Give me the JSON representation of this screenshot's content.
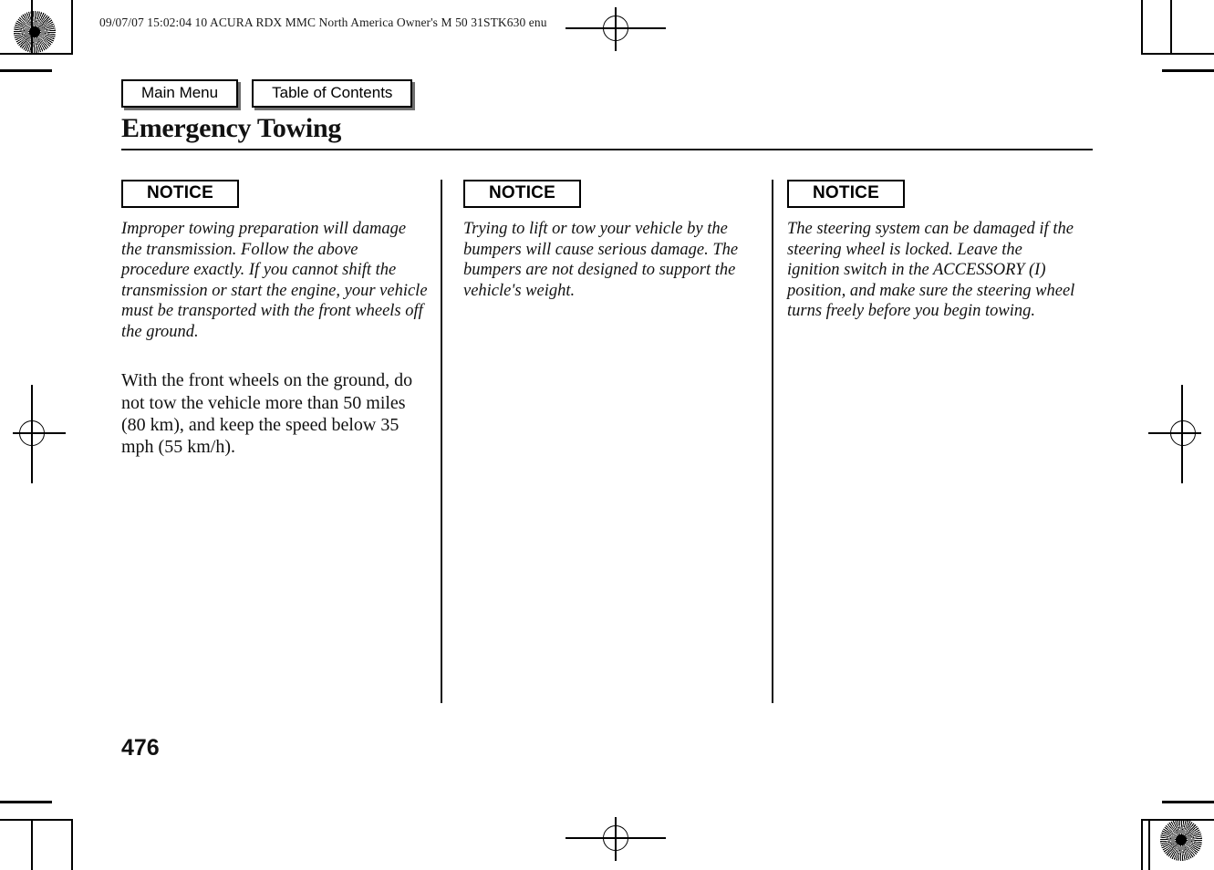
{
  "document": {
    "meta_line": "09/07/07 15:02:04   10 ACURA RDX MMC North America Owner's M 50 31STK630 enu",
    "title": "Emergency Towing",
    "page_number": "476"
  },
  "nav": {
    "main_menu": "Main Menu",
    "table_of_contents": "Table of Contents"
  },
  "columns": [
    {
      "badge": "NOTICE",
      "notice": "Improper towing preparation will damage the transmission. Follow the above procedure exactly. If you cannot shift the transmission or start the engine, your vehicle must be transported with the front wheels off the ground.",
      "body": "With the front wheels on the ground, do not tow the vehicle more than 50 miles (80 km), and keep the speed below 35 mph (55 km/h)."
    },
    {
      "badge": "NOTICE",
      "notice": "Trying to lift or tow your vehicle by the bumpers will cause serious damage. The bumpers are not designed to support the vehicle's weight.",
      "body": ""
    },
    {
      "badge": "NOTICE",
      "notice": "The steering system can be damaged if the steering wheel is locked. Leave the ignition switch in the ACCESSORY (I) position, and make sure the steering wheel turns freely before you begin towing.",
      "body": ""
    }
  ],
  "colors": {
    "ink": "#111111",
    "page": "#ffffff",
    "button_shadow": "#6f6f6f"
  }
}
